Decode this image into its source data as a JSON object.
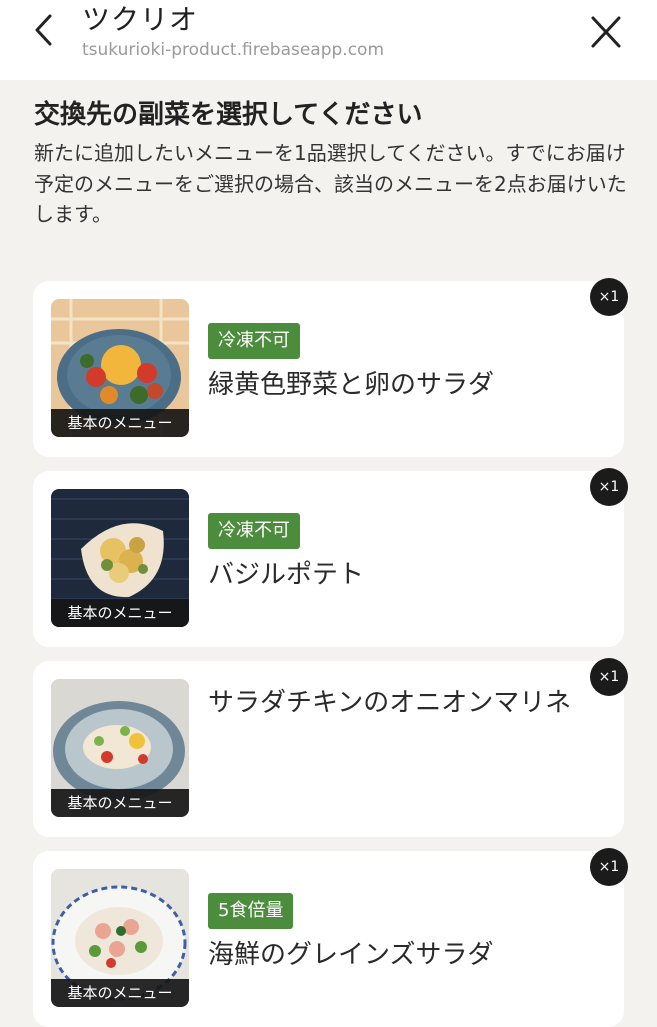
{
  "header": {
    "title": "ツクリオ",
    "url": "tsukurioki-product.firebaseapp.com"
  },
  "page": {
    "heading": "交換先の副菜を選択してください",
    "description": "新たに追加したいメニューを1品選択してください。すでにお届け予定のメニューをご選択の場合、該当のメニューを2点お届けいたします。"
  },
  "menu_items": [
    {
      "tag": "冷凍不可",
      "name": "緑黄色野菜と卵のサラダ",
      "badge": "基本のメニュー",
      "qty": "×1",
      "image_icon": "salad-egg-image"
    },
    {
      "tag": "冷凍不可",
      "name": "バジルポテト",
      "badge": "基本のメニュー",
      "qty": "×1",
      "image_icon": "basil-potato-image"
    },
    {
      "tag": "",
      "name": "サラダチキンのオニオンマリネ",
      "badge": "基本のメニュー",
      "qty": "×1",
      "image_icon": "chicken-marinade-image"
    },
    {
      "tag": "5食倍量",
      "name": "海鮮のグレインズサラダ",
      "badge": "基本のメニュー",
      "qty": "×1",
      "image_icon": "seafood-grain-salad-image"
    }
  ],
  "colors": {
    "tag_green": "#4c8c3d",
    "background": "#f4f2ef",
    "qty_badge": "#1b1b1b"
  }
}
